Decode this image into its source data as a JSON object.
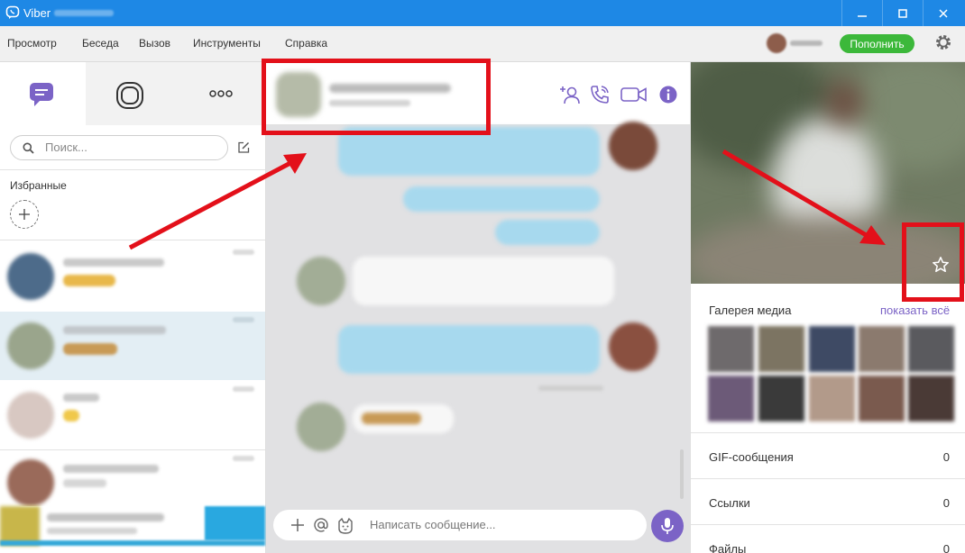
{
  "window": {
    "title": "Viber",
    "controls": {
      "minimize": "minimize",
      "maximize": "maximize",
      "close": "close"
    }
  },
  "menubar": {
    "items": [
      "Просмотр",
      "Беседа",
      "Вызов",
      "Инструменты",
      "Справка"
    ],
    "topup_label": "Пополнить"
  },
  "left_panel": {
    "search_placeholder": "Поиск...",
    "favorites_label": "Избранные"
  },
  "chat": {
    "message_placeholder": "Написать сообщение..."
  },
  "right_panel": {
    "gallery_label": "Галерея медиа",
    "show_all_label": "показать всё",
    "info_rows": [
      {
        "label": "GIF-сообщения",
        "count": "0"
      },
      {
        "label": "Ссылки",
        "count": "0"
      },
      {
        "label": "Файлы",
        "count": "0"
      }
    ]
  },
  "colors": {
    "titlebar": "#1e88e5",
    "accent": "#7b63c6",
    "topup_green": "#3cb83a",
    "annotation_red": "#e3101a"
  },
  "icons": [
    "viber-logo-icon",
    "chat-icon",
    "stories-icon",
    "more-icon",
    "search-icon",
    "compose-icon",
    "add-icon",
    "add-participant-icon",
    "voice-call-icon",
    "video-call-icon",
    "info-icon",
    "star-icon",
    "plus-icon",
    "at-icon",
    "sticker-icon",
    "mic-icon",
    "gear-icon"
  ]
}
